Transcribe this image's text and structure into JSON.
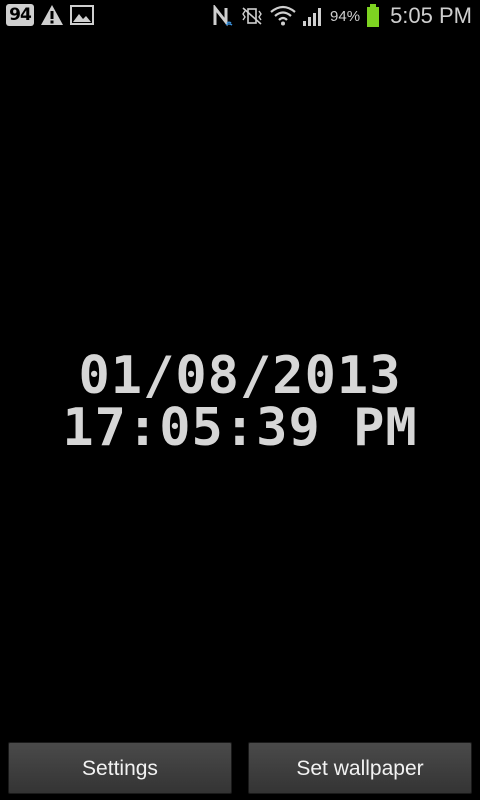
{
  "status_bar": {
    "notification_count": "94",
    "battery_percent": "94%",
    "time": "5:05 PM",
    "icons": [
      "warning-icon",
      "image-icon",
      "nfc-icon",
      "vibrate-mute-icon",
      "wifi-icon",
      "signal-icon",
      "battery-icon"
    ],
    "accent_battery": "#7ed321"
  },
  "wallpaper": {
    "date": "01/08/2013",
    "time": "17:05:39 PM",
    "text_color": "#d6d6d6"
  },
  "buttons": {
    "settings_label": "Settings",
    "set_wallpaper_label": "Set wallpaper"
  }
}
